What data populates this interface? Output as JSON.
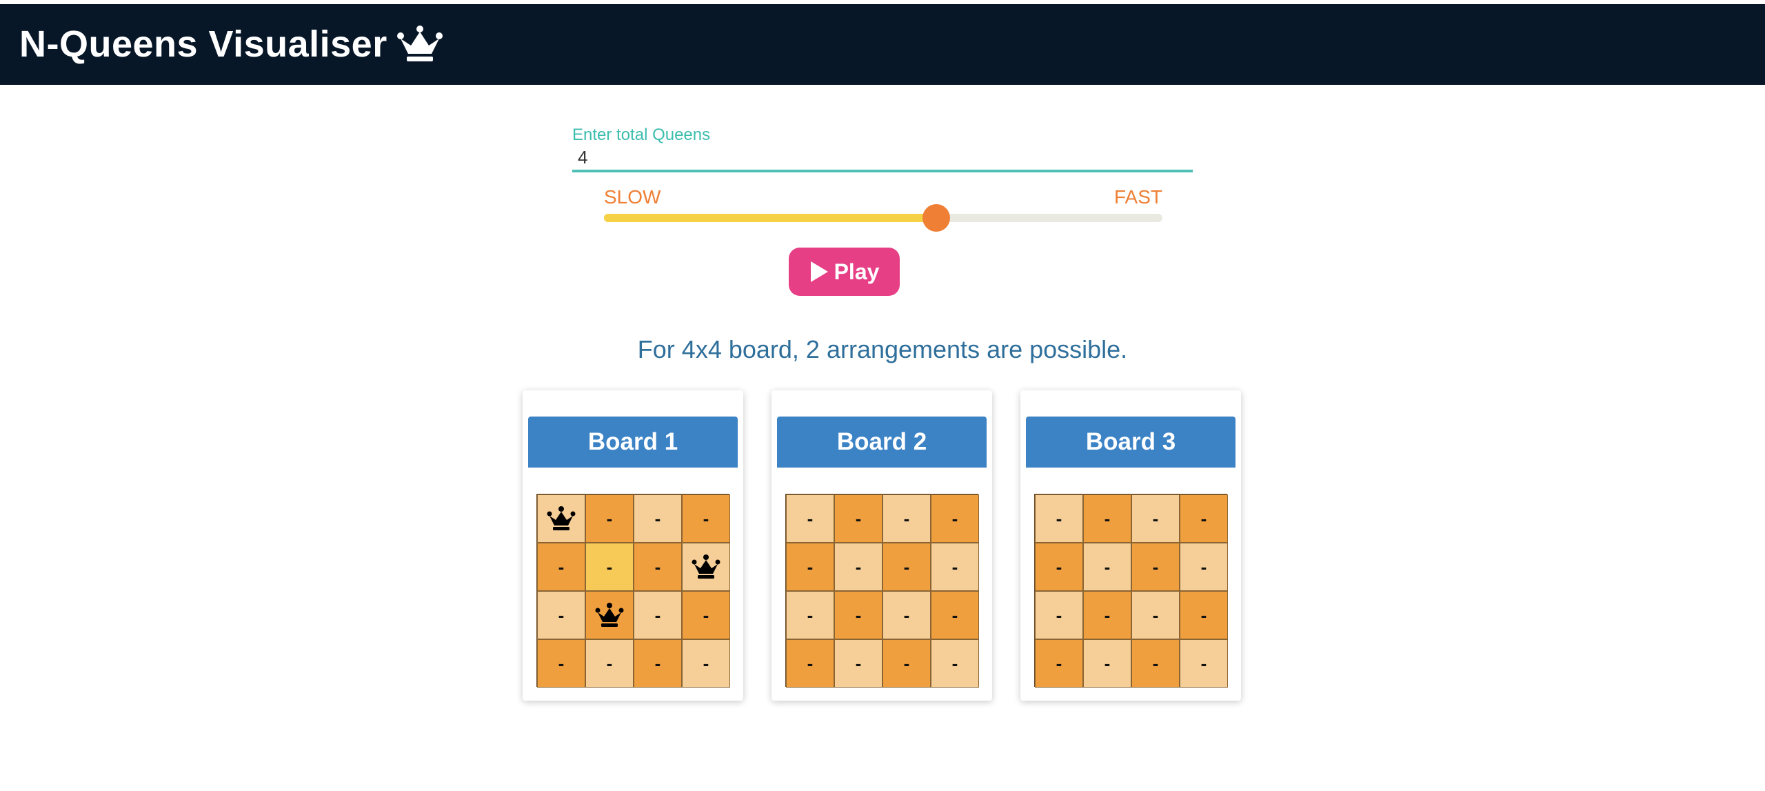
{
  "app": {
    "title": "N-Queens Visualiser",
    "crown_icon": "crown-icon"
  },
  "queens_input": {
    "label": "Enter total Queens",
    "value": "4"
  },
  "speed": {
    "slow_label": "SLOW",
    "fast_label": "FAST",
    "level": 0.595
  },
  "play_button": {
    "label": "Play",
    "icon": "play-icon"
  },
  "result_text": "For 4x4 board, 2 arrangements are possible.",
  "colors": {
    "navbar": "#081728",
    "accent_teal": "#3cbdae",
    "accent_orange": "#ee7f35",
    "play_pink": "#e63f86",
    "board_header_blue": "#3c83c6",
    "cell_light": "#f5cf97",
    "cell_dark": "#f09f3e",
    "cell_active": "#f7c957"
  },
  "boards": [
    {
      "title": "Board 1",
      "cells": [
        [
          "Q",
          "-",
          "-",
          "-"
        ],
        [
          "-",
          "-",
          "-",
          "Q"
        ],
        [
          "-",
          "Q",
          "-",
          "-"
        ],
        [
          "-",
          "-",
          "-",
          "-"
        ]
      ],
      "active_cell": [
        1,
        1
      ]
    },
    {
      "title": "Board 2",
      "cells": [
        [
          "-",
          "-",
          "-",
          "-"
        ],
        [
          "-",
          "-",
          "-",
          "-"
        ],
        [
          "-",
          "-",
          "-",
          "-"
        ],
        [
          "-",
          "-",
          "-",
          "-"
        ]
      ]
    },
    {
      "title": "Board 3",
      "cells": [
        [
          "-",
          "-",
          "-",
          "-"
        ],
        [
          "-",
          "-",
          "-",
          "-"
        ],
        [
          "-",
          "-",
          "-",
          "-"
        ],
        [
          "-",
          "-",
          "-",
          "-"
        ]
      ]
    }
  ]
}
